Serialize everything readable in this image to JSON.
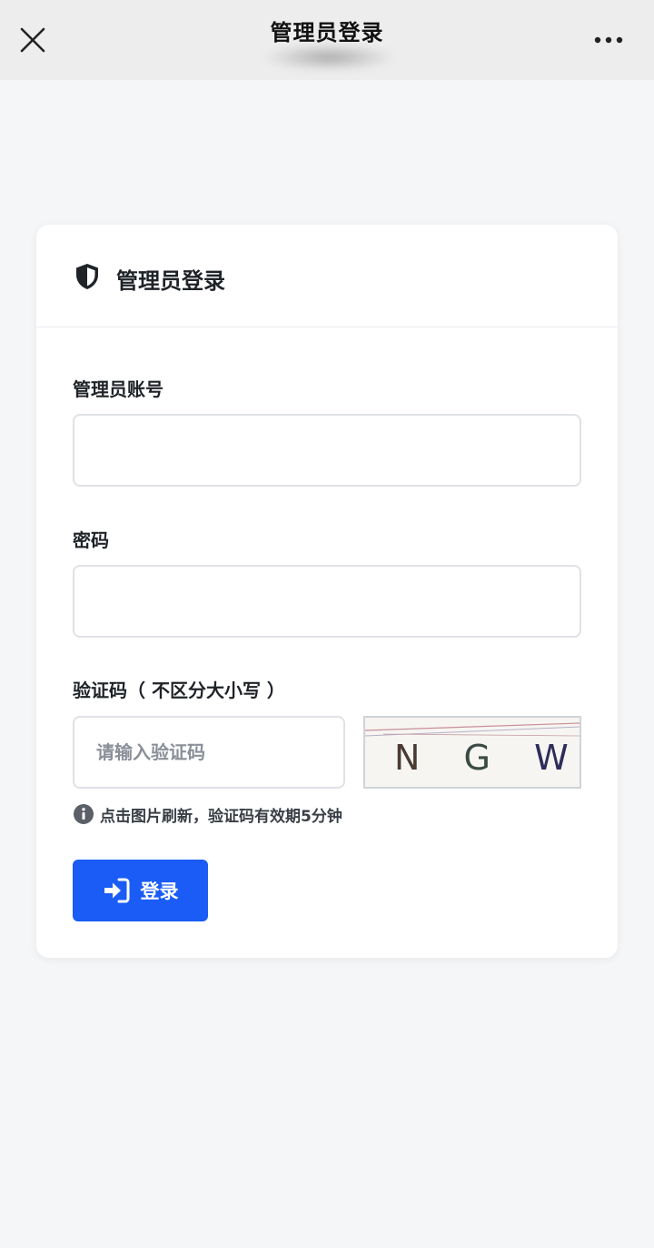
{
  "titlebar": {
    "title": "管理员登录",
    "close_icon": "close-icon",
    "more_icon": "more-icon"
  },
  "card": {
    "title": "管理员登录",
    "title_icon": "shield-icon"
  },
  "form": {
    "account_label": "管理员账号",
    "account_value": "",
    "password_label": "密码",
    "password_value": "",
    "captcha_label": "验证码（ 不区分大小写 ）",
    "captcha_placeholder": "请输入验证码",
    "captcha_text": "NGWP",
    "hint_icon": "info-icon",
    "hint_text": "点击图片刷新，验证码有效期5分钟"
  },
  "login_button": {
    "label": "登录",
    "icon": "sign-in-icon"
  },
  "colors": {
    "primary": "#1a5cf5",
    "background": "#f5f6f8",
    "titlebar": "#ededed"
  }
}
